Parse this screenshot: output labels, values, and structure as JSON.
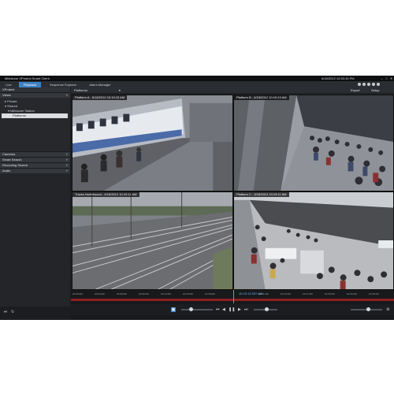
{
  "app": {
    "title": "Milestone XProtect Smart Client",
    "datetime": "6/18/2012 10:53:15 PM",
    "window_buttons": [
      "–",
      "□",
      "✕"
    ]
  },
  "tabs": [
    {
      "label": "Live",
      "active": false
    },
    {
      "label": "Playback",
      "active": true
    },
    {
      "label": "Sequence Explorer",
      "active": false
    },
    {
      "label": "Alarm Manager",
      "active": false
    }
  ],
  "sidebar": {
    "header": "XProtect",
    "views_label": "Views",
    "tree": [
      {
        "label": "▸ Private",
        "indent": 1
      },
      {
        "label": "▾ Shared",
        "indent": 1
      },
      {
        "label": "▾ Milestone Station",
        "indent": 2
      },
      {
        "label": "Platforms",
        "indent": 3,
        "selected": true
      }
    ],
    "sections": [
      "Cameras",
      "Smart Search",
      "Recording Search",
      "Audio"
    ]
  },
  "viewbar": {
    "view_name": "Platforms",
    "export_label": "Export",
    "setup_label": "Setup"
  },
  "cameras": [
    {
      "title": "Platform A - 6/18/2012 10:19:13 AM"
    },
    {
      "title": "Platform B - 6/18/2012 10:19:13 AM"
    },
    {
      "title": "Tracks Northbound - 6/18/2012 10:19:11 AM"
    },
    {
      "title": "Platform C - 6/18/2012 10:19:11 AM"
    }
  ],
  "timeline": {
    "ticks": [
      "10:00 AM",
      "10:03 AM",
      "10:06 AM",
      "10:09 AM",
      "10:12 AM",
      "10:15 AM",
      "10:18 AM",
      "10:19:13.337 AM",
      "10:21 AM",
      "10:24 AM",
      "10:27 AM",
      "10:30 AM",
      "10:33 AM",
      "10:36 AM",
      "10:39 AM"
    ],
    "current_time": "10:19:13.337 AM 6/18/2012",
    "recording_color": "#8e1e22",
    "cursor_color": "#4fa0ff"
  },
  "colors": {
    "accent": "#3d82c4",
    "background": "#1b1d20"
  },
  "icons": {
    "play": "▶",
    "pause": "❚❚",
    "prev": "⏮",
    "next": "⏭",
    "rewind": "◀",
    "settings": "⚙"
  }
}
